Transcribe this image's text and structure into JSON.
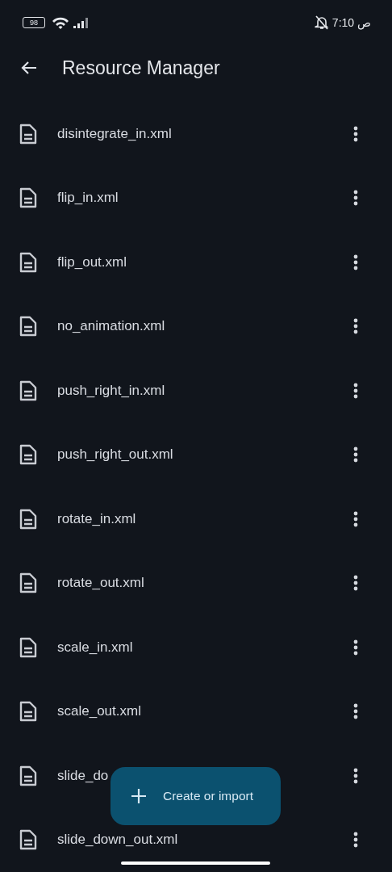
{
  "status_bar": {
    "battery": "98",
    "time": "ص 7:10"
  },
  "app_bar": {
    "title": "Resource Manager"
  },
  "files": [
    {
      "name": "disintegrate_in.xml"
    },
    {
      "name": "flip_in.xml"
    },
    {
      "name": "flip_out.xml"
    },
    {
      "name": "no_animation.xml"
    },
    {
      "name": "push_right_in.xml"
    },
    {
      "name": "push_right_out.xml"
    },
    {
      "name": "rotate_in.xml"
    },
    {
      "name": "rotate_out.xml"
    },
    {
      "name": "scale_in.xml"
    },
    {
      "name": "scale_out.xml"
    },
    {
      "name": "slide_do"
    },
    {
      "name": "slide_down_out.xml"
    }
  ],
  "fab": {
    "label": "Create or import"
  }
}
